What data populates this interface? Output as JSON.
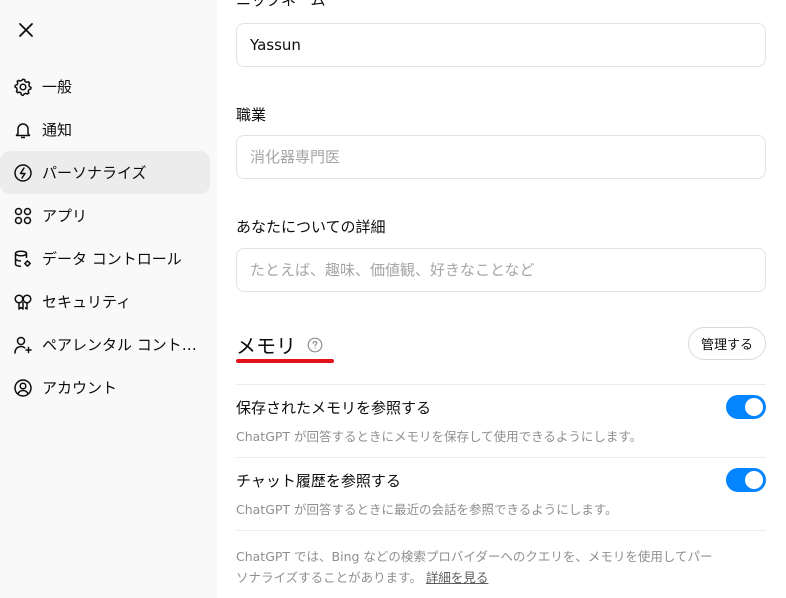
{
  "sidebar": {
    "items": [
      {
        "label": "一般",
        "icon": "gear-icon"
      },
      {
        "label": "通知",
        "icon": "bell-icon"
      },
      {
        "label": "パーソナライズ",
        "icon": "personalize-icon",
        "active": true
      },
      {
        "label": "アプリ",
        "icon": "apps-grid-icon"
      },
      {
        "label": "データ コントロール",
        "icon": "database-gear-icon"
      },
      {
        "label": "セキュリティ",
        "icon": "key-icon"
      },
      {
        "label": "ペアレンタル コントロール",
        "icon": "parental-user-icon"
      },
      {
        "label": "アカウント",
        "icon": "account-circle-icon"
      }
    ]
  },
  "form": {
    "nickname_label": "ニックネーム",
    "nickname_value": "Yassun",
    "occupation_label": "職業",
    "occupation_placeholder": "消化器専門医",
    "about_label": "あなたについての詳細",
    "about_placeholder": "たとえば、趣味、価値観、好きなことなど"
  },
  "memory": {
    "title": "メモリ",
    "manage_label": "管理する",
    "saved": {
      "title": "保存されたメモリを参照する",
      "desc": "ChatGPT が回答するときにメモリを保存して使用できるようにします。",
      "enabled": true
    },
    "history": {
      "title": "チャット履歴を参照する",
      "desc": "ChatGPT が回答するときに最近の会話を参照できるようにします。",
      "enabled": true
    },
    "footer_text": "ChatGPT では、Bing などの検索プロバイダーへのクエリを、メモリを使用してパーソナライズすることがあります。",
    "footer_link": "詳細を見る"
  },
  "colors": {
    "accent_toggle": "#0285ff",
    "underline_red": "#e3141b",
    "sidebar_bg": "#f9f9f9",
    "active_bg": "#ececec"
  }
}
